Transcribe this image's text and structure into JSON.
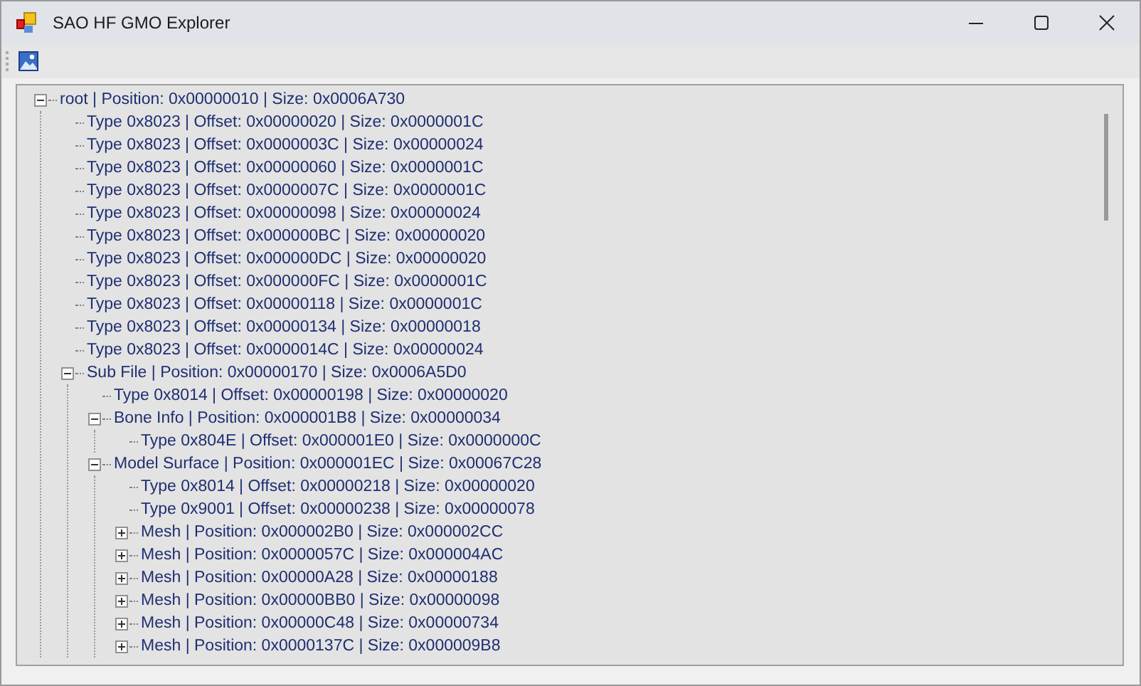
{
  "window": {
    "title": "SAO HF GMO Explorer"
  },
  "tree": [
    {
      "label": "root | Position:  0x00000010 | Size:  0x0006A730",
      "expanded": true,
      "children": [
        {
          "label": "Type 0x8023 | Offset:  0x00000020 | Size:  0x0000001C"
        },
        {
          "label": "Type 0x8023 | Offset:  0x0000003C | Size:  0x00000024"
        },
        {
          "label": "Type 0x8023 | Offset:  0x00000060 | Size:  0x0000001C"
        },
        {
          "label": "Type 0x8023 | Offset:  0x0000007C | Size:  0x0000001C"
        },
        {
          "label": "Type 0x8023 | Offset:  0x00000098 | Size:  0x00000024"
        },
        {
          "label": "Type 0x8023 | Offset:  0x000000BC | Size:  0x00000020"
        },
        {
          "label": "Type 0x8023 | Offset:  0x000000DC | Size:  0x00000020"
        },
        {
          "label": "Type 0x8023 | Offset:  0x000000FC | Size:  0x0000001C"
        },
        {
          "label": "Type 0x8023 | Offset:  0x00000118 | Size:  0x0000001C"
        },
        {
          "label": "Type 0x8023 | Offset:  0x00000134 | Size:  0x00000018"
        },
        {
          "label": "Type 0x8023 | Offset:  0x0000014C | Size:  0x00000024"
        },
        {
          "label": "Sub File | Position:  0x00000170 | Size:  0x0006A5D0",
          "expanded": true,
          "children": [
            {
              "label": "Type 0x8014 | Offset:  0x00000198 | Size:  0x00000020"
            },
            {
              "label": "Bone Info | Position:  0x000001B8 | Size:  0x00000034",
              "expanded": true,
              "children": [
                {
                  "label": "Type 0x804E | Offset:  0x000001E0 | Size:  0x0000000C"
                }
              ]
            },
            {
              "label": "Model Surface | Position:  0x000001EC | Size:  0x00067C28",
              "expanded": true,
              "children": [
                {
                  "label": "Type 0x8014 | Offset:  0x00000218 | Size:  0x00000020"
                },
                {
                  "label": "Type 0x9001 | Offset:  0x00000238 | Size:  0x00000078"
                },
                {
                  "label": "Mesh | Position:  0x000002B0 | Size:  0x000002CC",
                  "expanded": false
                },
                {
                  "label": "Mesh | Position:  0x0000057C | Size:  0x000004AC",
                  "expanded": false
                },
                {
                  "label": "Mesh | Position:  0x00000A28 | Size:  0x00000188",
                  "expanded": false
                },
                {
                  "label": "Mesh | Position:  0x00000BB0 | Size:  0x00000098",
                  "expanded": false
                },
                {
                  "label": "Mesh | Position:  0x00000C48 | Size:  0x00000734",
                  "expanded": false
                },
                {
                  "label": "Mesh | Position:  0x0000137C | Size:  0x000009B8",
                  "expanded": false
                }
              ]
            }
          ]
        }
      ]
    }
  ]
}
